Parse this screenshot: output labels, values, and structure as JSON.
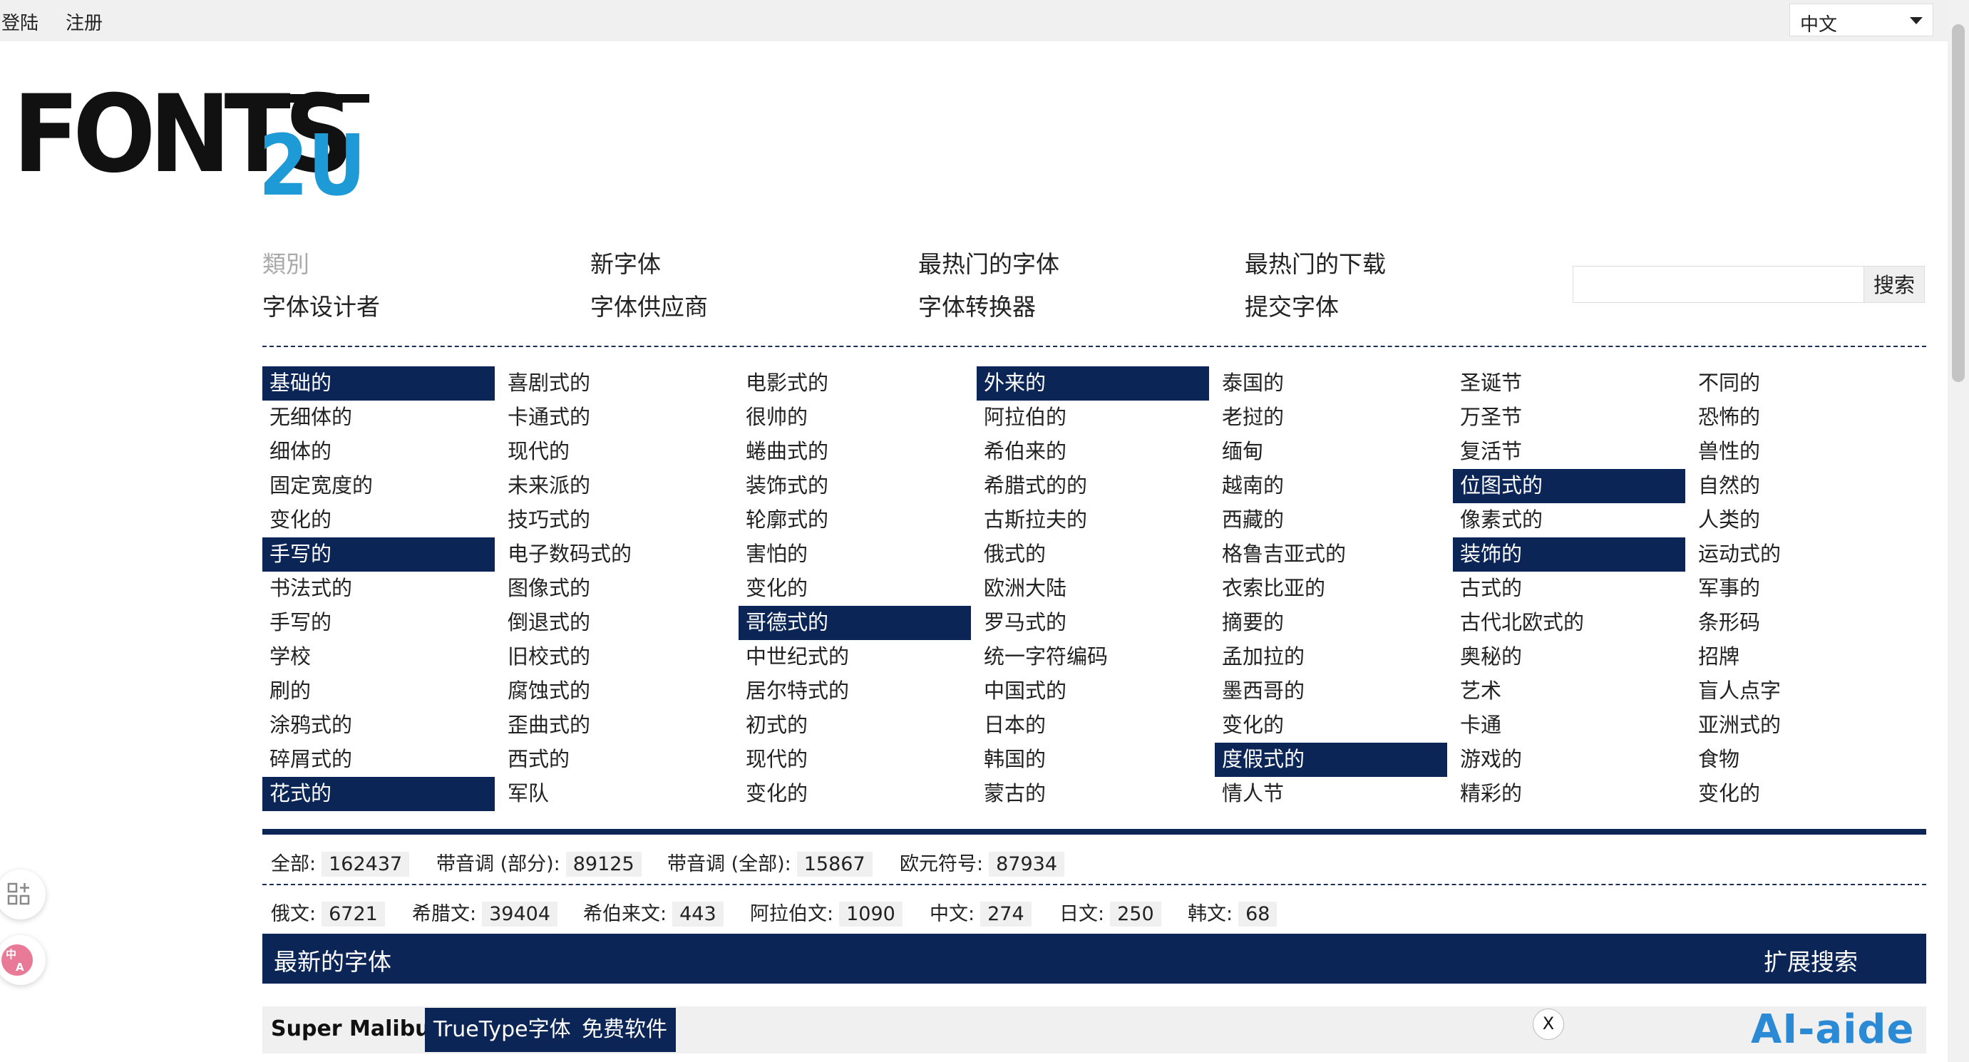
{
  "topbar": {
    "login": "登陆",
    "register": "注册",
    "language": "中文"
  },
  "logo": {
    "text_dark": "FONTS",
    "text_blue": "2U",
    "blue_color": "#1e9ad6"
  },
  "nav": {
    "row1": [
      "類別",
      "新字体",
      "最热门的字体",
      "最热门的下载"
    ],
    "row2": [
      "字体设计者",
      "字体供应商",
      "字体转换器",
      "提交字体"
    ],
    "search_button": "搜索",
    "search_value": ""
  },
  "categories": {
    "col1": [
      {
        "label": "基础的",
        "header": true
      },
      {
        "label": "无细体的"
      },
      {
        "label": "细体的"
      },
      {
        "label": "固定宽度的"
      },
      {
        "label": "变化的"
      },
      {
        "label": "手写的",
        "header": true
      },
      {
        "label": "书法式的"
      },
      {
        "label": "手写的"
      },
      {
        "label": "学校"
      },
      {
        "label": "刷的"
      },
      {
        "label": "涂鸦式的"
      },
      {
        "label": "碎屑式的"
      },
      {
        "label": "花式的",
        "header": true
      }
    ],
    "col2": [
      {
        "label": "喜剧式的"
      },
      {
        "label": "卡通式的"
      },
      {
        "label": "现代的"
      },
      {
        "label": "未来派的"
      },
      {
        "label": "技巧式的"
      },
      {
        "label": "电子数码式的"
      },
      {
        "label": "图像式的"
      },
      {
        "label": "倒退式的"
      },
      {
        "label": "旧校式的"
      },
      {
        "label": "腐蚀式的"
      },
      {
        "label": "歪曲式的"
      },
      {
        "label": "西式的"
      },
      {
        "label": "军队"
      }
    ],
    "col3": [
      {
        "label": "电影式的"
      },
      {
        "label": "很帅的"
      },
      {
        "label": "蜷曲式的"
      },
      {
        "label": "装饰式的"
      },
      {
        "label": "轮廓式的"
      },
      {
        "label": "害怕的"
      },
      {
        "label": "变化的"
      },
      {
        "label": "哥德式的",
        "header": true
      },
      {
        "label": "中世纪式的"
      },
      {
        "label": "居尔特式的"
      },
      {
        "label": "初式的"
      },
      {
        "label": "现代的"
      },
      {
        "label": "变化的"
      }
    ],
    "col4": [
      {
        "label": "外来的",
        "header": true
      },
      {
        "label": "阿拉伯的"
      },
      {
        "label": "希伯来的"
      },
      {
        "label": "希腊式的的"
      },
      {
        "label": "古斯拉夫的"
      },
      {
        "label": "俄式的"
      },
      {
        "label": "欧洲大陆"
      },
      {
        "label": "罗马式的"
      },
      {
        "label": "统一字符编码"
      },
      {
        "label": "中国式的"
      },
      {
        "label": "日本的"
      },
      {
        "label": "韩国的"
      },
      {
        "label": "蒙古的"
      }
    ],
    "col5": [
      {
        "label": "泰国的"
      },
      {
        "label": "老挝的"
      },
      {
        "label": "缅甸"
      },
      {
        "label": "越南的"
      },
      {
        "label": "西藏的"
      },
      {
        "label": "格鲁吉亚式的"
      },
      {
        "label": "衣索比亚的"
      },
      {
        "label": "摘要的"
      },
      {
        "label": "孟加拉的"
      },
      {
        "label": "墨西哥的"
      },
      {
        "label": "变化的"
      },
      {
        "label": "度假式的",
        "header": true
      },
      {
        "label": "情人节"
      }
    ],
    "col6": [
      {
        "label": "圣诞节"
      },
      {
        "label": "万圣节"
      },
      {
        "label": "复活节"
      },
      {
        "label": "位图式的",
        "header": true
      },
      {
        "label": "像素式的"
      },
      {
        "label": "装饰的",
        "header": true
      },
      {
        "label": "古式的"
      },
      {
        "label": "古代北欧式的"
      },
      {
        "label": "奥秘的"
      },
      {
        "label": "艺术"
      },
      {
        "label": "卡通"
      },
      {
        "label": "游戏的"
      },
      {
        "label": "精彩的"
      }
    ],
    "col7": [
      {
        "label": "不同的"
      },
      {
        "label": "恐怖的"
      },
      {
        "label": "兽性的"
      },
      {
        "label": "自然的"
      },
      {
        "label": "人类的"
      },
      {
        "label": "运动式的"
      },
      {
        "label": "军事的"
      },
      {
        "label": "条形码"
      },
      {
        "label": "招牌"
      },
      {
        "label": "盲人点字"
      },
      {
        "label": "亚洲式的"
      },
      {
        "label": "食物"
      },
      {
        "label": "变化的"
      }
    ]
  },
  "stats": {
    "row1": [
      {
        "label": "全部:",
        "value": "162437"
      },
      {
        "label": "带音调 (部分):",
        "value": "89125"
      },
      {
        "label": "带音调 (全部):",
        "value": "15867"
      },
      {
        "label": "欧元符号:",
        "value": "87934"
      }
    ],
    "row2": [
      {
        "label": "俄文:",
        "value": "6721"
      },
      {
        "label": "希腊文:",
        "value": "39404"
      },
      {
        "label": "希伯来文:",
        "value": "443"
      },
      {
        "label": "阿拉伯文:",
        "value": "1090"
      },
      {
        "label": "中文:",
        "value": "274"
      },
      {
        "label": "日文:",
        "value": "250"
      },
      {
        "label": "韩文:",
        "value": "68"
      }
    ]
  },
  "newest": {
    "title": "最新的字体",
    "expand": "扩展搜索"
  },
  "entry": {
    "name": "Super Malibu",
    "tags": [
      "TrueType字体",
      "免费软件"
    ]
  },
  "close_label": "X",
  "watermark": "AI-aide",
  "colors": {
    "navy": "#0b2656",
    "topbar": "#f0f0f0"
  },
  "side_icons": [
    "apps-add-icon",
    "translate-icon"
  ]
}
